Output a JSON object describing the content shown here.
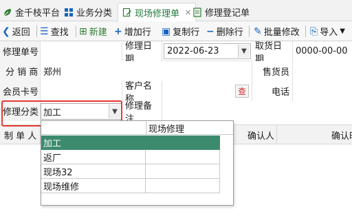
{
  "tabs": [
    {
      "label": "金千枝平台",
      "icon": "leaf-icon"
    },
    {
      "label": "业务分类",
      "icon": "grid-icon"
    },
    {
      "label": "现场修理单",
      "icon": "edit-doc-icon",
      "active": true
    },
    {
      "label": "修理登记单",
      "icon": "doc-list-icon"
    }
  ],
  "toolbar": {
    "back": "返回",
    "find": "查找",
    "new": "新建",
    "add_row": "增加行",
    "copy_row": "复制行",
    "delete_row": "删除行",
    "batch_edit": "批量修改",
    "import": "导入"
  },
  "form": {
    "repair_no_label": "修理单号",
    "repair_no_value": "",
    "repair_date_label": "修理日期",
    "repair_date_value": "2022-06-23",
    "pickup_date_label": "取货日期",
    "pickup_date_value": "0000-00-00",
    "distributor_label": "分 销 商",
    "distributor_value": "郑州",
    "salesperson_label": "售货员",
    "member_card_label": "会员卡号",
    "customer_name_label": "客户名称",
    "lookup_label": "查",
    "phone_label": "电话",
    "category_label": "修理分类",
    "category_value": "加工",
    "note_label": "修理备注"
  },
  "grid": {
    "headers": [
      "制 单 人",
      "确认人",
      "确认时"
    ]
  },
  "dropdown": {
    "header_col2": "现场修理",
    "options": [
      "加工",
      "返厂",
      "现场32",
      "现场维修"
    ],
    "selected_index": 0
  },
  "colors": {
    "accent_green": "#1f7a3a",
    "selected_row": "#3d8b6e",
    "highlight_red": "#e53935"
  }
}
